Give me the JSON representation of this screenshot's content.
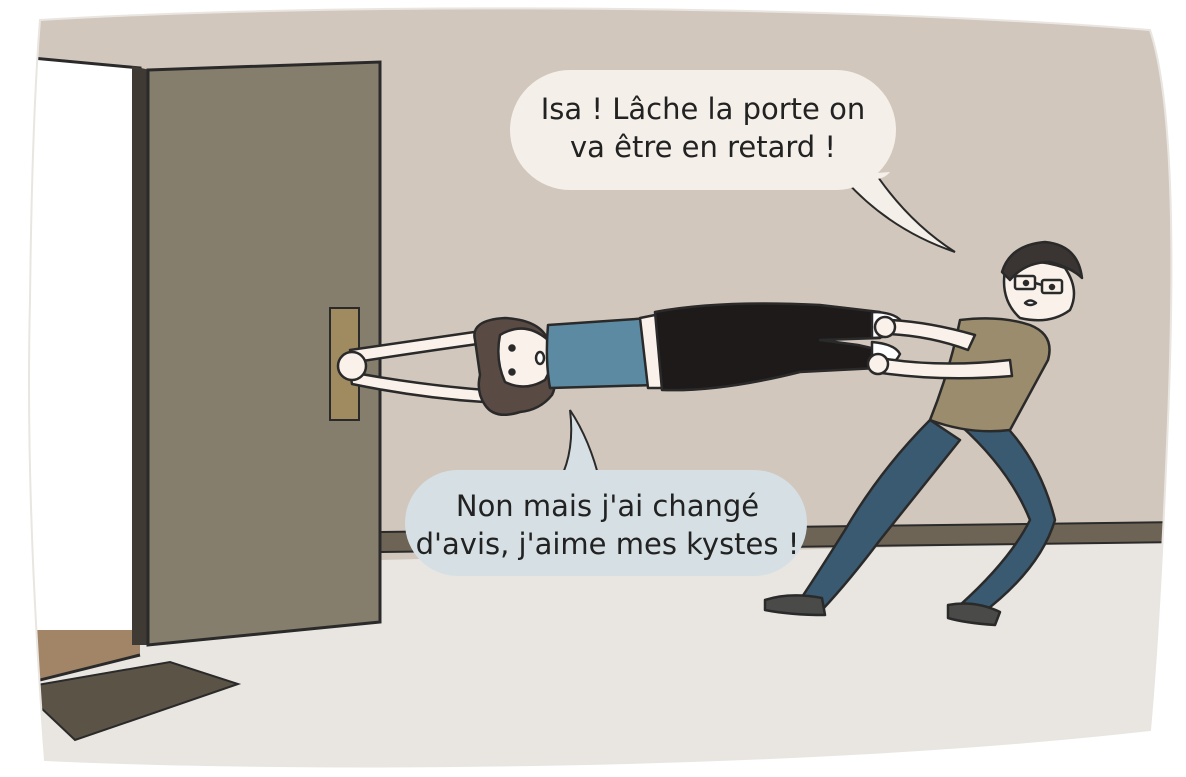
{
  "panel": {
    "colors": {
      "wall": "#d2c7bd",
      "floor": "#e9e6e1",
      "door": "#857e6c",
      "door_edge": "#3f3a33",
      "baseboard": "#6e6455",
      "doorway_light": "#ffffff",
      "threshold": "#a28467",
      "doormat": "#5b5346",
      "handle_plate": "#a08b60",
      "bubble_man": "#f4efe8",
      "bubble_woman": "#d6e0e4",
      "woman_top": "#5c8aa3",
      "woman_hair": "#5a4a44",
      "woman_pants": "#1e1a1a",
      "man_shirt": "#9a8c6c",
      "man_jeans": "#3a5a72",
      "man_hair": "#3a3532",
      "skin": "#faf2ea",
      "outline": "#2a2a2a"
    },
    "speech": {
      "man": {
        "lines": [
          "Isa ! Lâche la porte on",
          "va être en retard !"
        ]
      },
      "woman": {
        "lines": [
          "Non mais j'ai changé",
          "d'avis, j'aime mes kystes !"
        ]
      }
    }
  }
}
